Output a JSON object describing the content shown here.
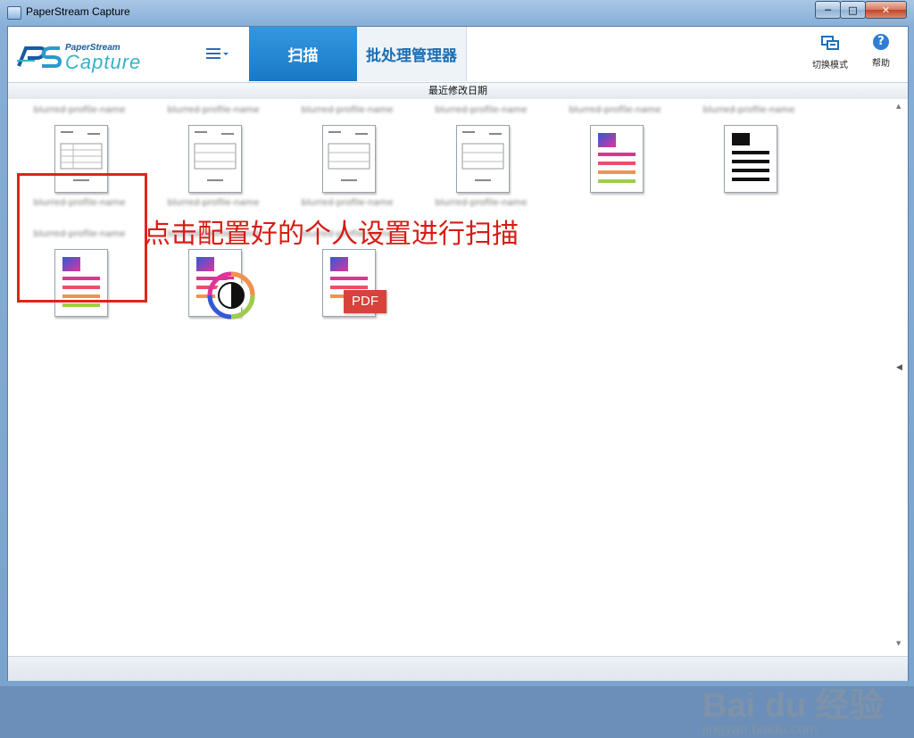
{
  "window": {
    "title": "PaperStream Capture",
    "minimize_icon": "minimize-icon",
    "maximize_icon": "maximize-icon",
    "close_icon": "close-icon"
  },
  "toolbar": {
    "logo_top": "PaperStream",
    "logo_bottom": "Capture",
    "menu_icon": "hamburger-menu-icon",
    "tabs": [
      {
        "label": "扫描",
        "active": true
      },
      {
        "label": "批处理管理器",
        "active": false
      }
    ],
    "switch_mode": {
      "label": "切换模式",
      "icon": "switch-mode-icon"
    },
    "help": {
      "label": "帮助",
      "icon": "help-icon",
      "glyph": "?"
    }
  },
  "sortbar": {
    "label": "最近修改日期"
  },
  "profiles": [
    {
      "label": "blurred-profile-name",
      "icon": "scanned-form-thumbnail-icon",
      "selected": true
    },
    {
      "label": "blurred-profile-name",
      "icon": "scanned-form-thumbnail-icon"
    },
    {
      "label": "blurred-profile-name",
      "icon": "scanned-form-thumbnail-icon"
    },
    {
      "label": "blurred-profile-name",
      "icon": "scanned-form-thumbnail-icon"
    },
    {
      "label": "blurred-profile-name",
      "icon": "color-document-icon"
    },
    {
      "label": "blurred-profile-name",
      "icon": "black-white-document-icon"
    },
    {
      "label": "blurred-profile-name",
      "icon": "color-document-icon"
    },
    {
      "label": "blurred-profile-name",
      "icon": "auto-color-document-icon"
    },
    {
      "label": "blurred-profile-name",
      "icon": "pdf-document-icon",
      "badge": "PDF"
    }
  ],
  "annotation": {
    "text": "点击配置好的个人设置进行扫描",
    "color": "#d61c15"
  },
  "watermark": {
    "brand": "Bai du 经验",
    "url": "jingyan.baidu.com"
  },
  "colors": {
    "accent": "#1a78c5",
    "highlight": "#e2231a"
  }
}
